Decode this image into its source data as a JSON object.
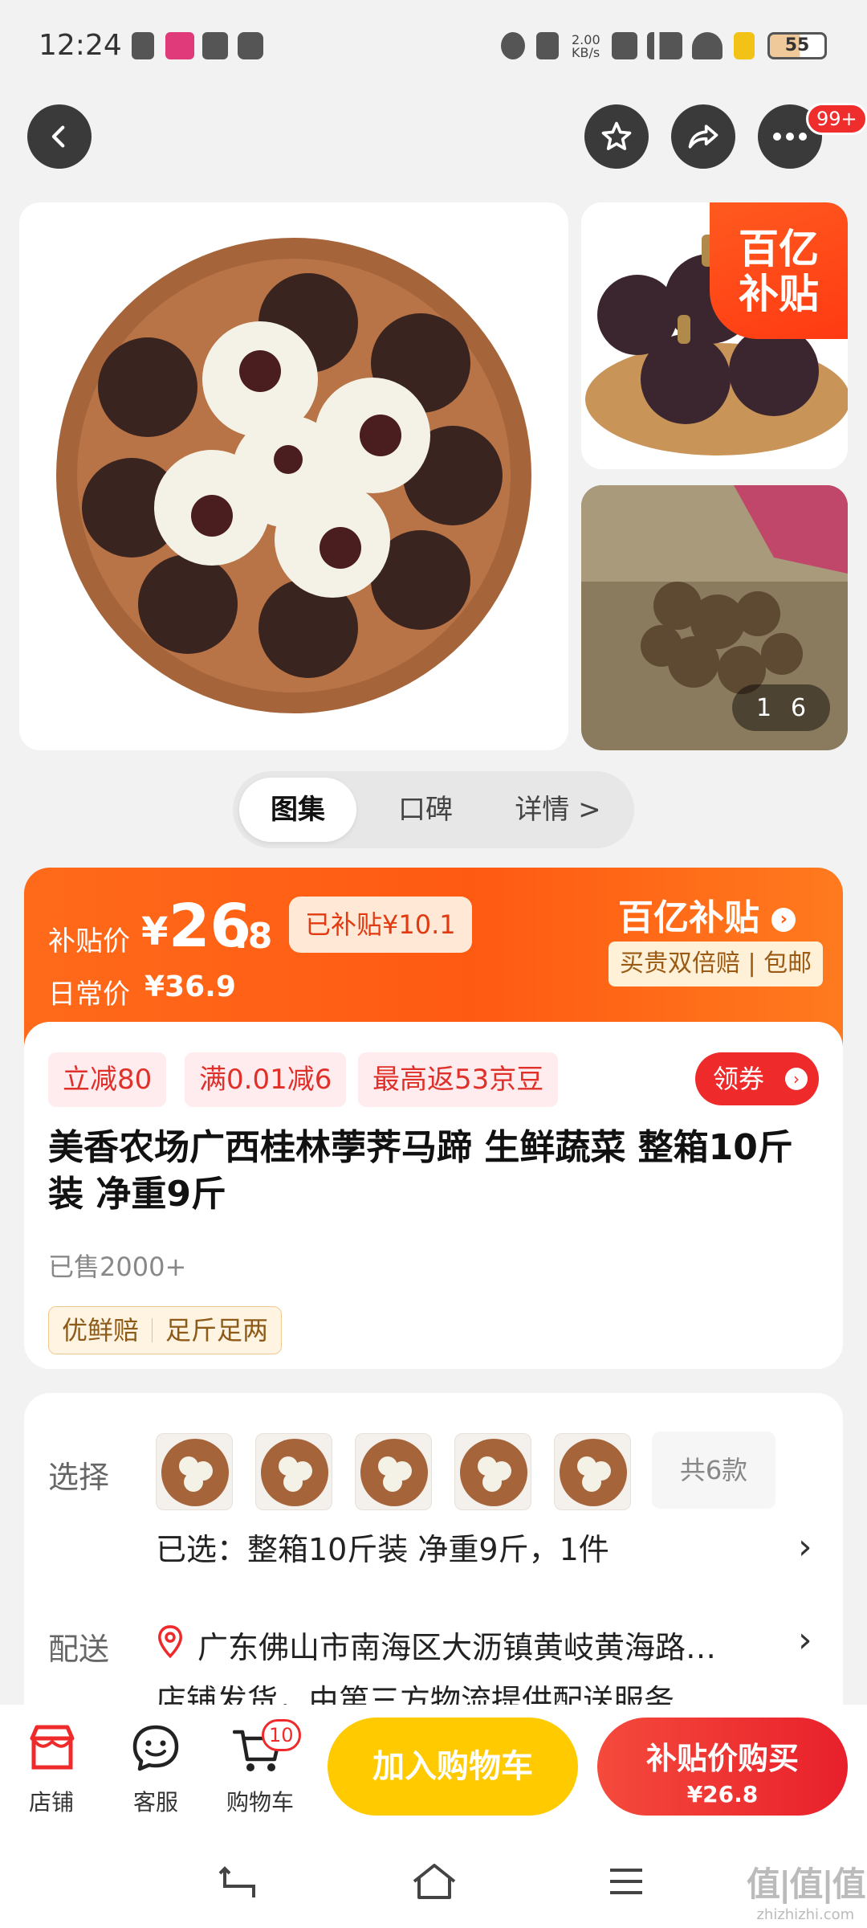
{
  "status_bar": {
    "time": "12:24",
    "net_speed": "2.00\nKB/s",
    "battery": "55"
  },
  "nav": {
    "more_badge": "99+"
  },
  "gallery": {
    "corner_badge_line1": "百亿",
    "corner_badge_line2": "补贴",
    "counter_current": "1",
    "counter_total": "6"
  },
  "tabs": [
    "图集",
    "口碑",
    "详情 >"
  ],
  "price": {
    "subsidy_label": "补贴价",
    "currency": "¥",
    "integer": "26",
    "decimal": ".8",
    "subsidized": "已补贴¥10.1",
    "daily_label": "日常价",
    "daily_price": "¥36.9",
    "brand": "百亿补贴",
    "brand_sub": "买贵双倍赔 | 包邮"
  },
  "promo_tags": [
    "立减80",
    "满0.01减6",
    "最高返53京豆"
  ],
  "coupon_label": "领券",
  "product": {
    "title": "美香农场广西桂林荸荠马蹄  生鲜蔬菜 整箱10斤装 净重9斤",
    "sold": "已售2000+",
    "fresh_tags": [
      "优鲜赔",
      "足斤足两"
    ]
  },
  "options": {
    "select_label": "选择",
    "variants_count": "共6款",
    "selected": "已选：整箱10斤装 净重9斤，1件",
    "delivery_label": "配送",
    "address": "广东佛山市南海区大沥镇黄岐黄海路…",
    "shipping": "店铺发货，由第三方物流提供配送服务"
  },
  "bottom_bar": {
    "shop": "店铺",
    "service": "客服",
    "cart": "购物车",
    "cart_badge": "10",
    "add_to_cart": "加入购物车",
    "buy_label": "补贴价购买",
    "buy_price": "¥26.8"
  },
  "watermark": {
    "line1": "值|值|值",
    "line2": "zhizhizhi.com"
  }
}
